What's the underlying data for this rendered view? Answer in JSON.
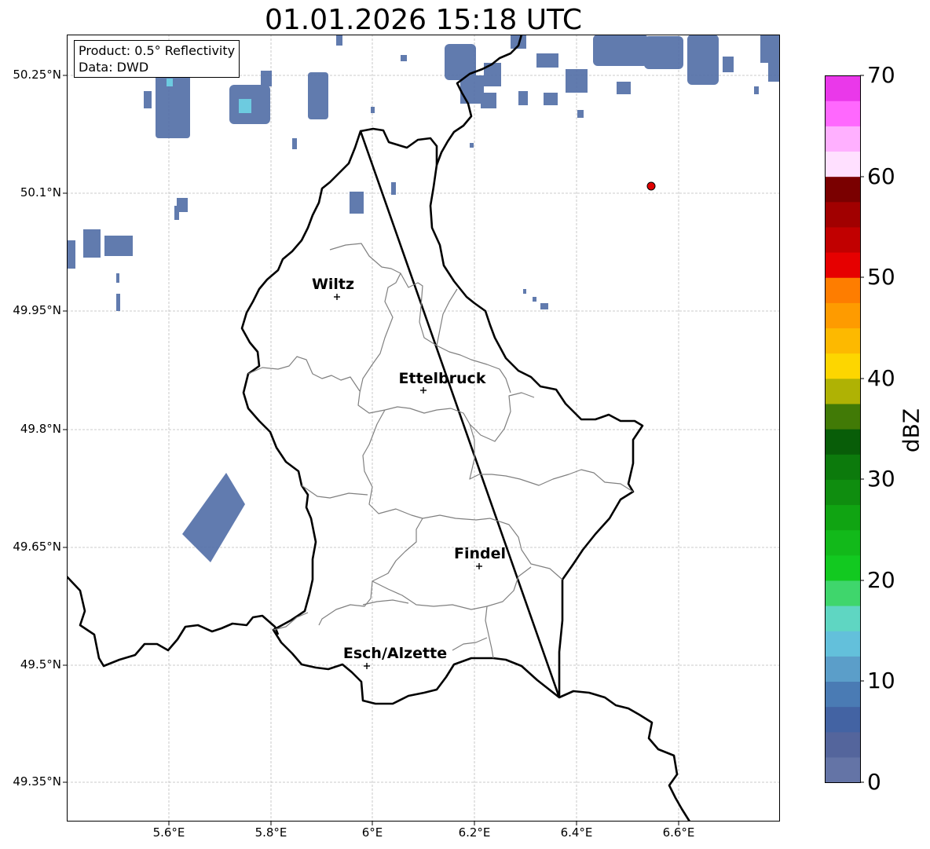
{
  "title": "01.01.2026 15:18 UTC",
  "info": {
    "product": "Product: 0.5° Reflectivity",
    "source": "Data: DWD"
  },
  "axes": {
    "y_ticks": [
      "50.25°N",
      "50.1°N",
      "49.95°N",
      "49.8°N",
      "49.65°N",
      "49.5°N",
      "49.35°N"
    ],
    "x_ticks": [
      "5.6°E",
      "5.8°E",
      "6°E",
      "6.2°E",
      "6.4°E",
      "6.6°E"
    ]
  },
  "cities": [
    {
      "name": "Wiltz"
    },
    {
      "name": "Ettelbruck"
    },
    {
      "name": "Findel"
    },
    {
      "name": "Esch/Alzette"
    }
  ],
  "colorbar": {
    "title": "dBZ",
    "tick_labels": [
      "70",
      "60",
      "50",
      "40",
      "30",
      "20",
      "10",
      "0"
    ],
    "colors": [
      "#6474a6",
      "#54659c",
      "#4363a3",
      "#4a7bb4",
      "#5b9ec9",
      "#63c0db",
      "#5fd6c2",
      "#3fd66c",
      "#12c920",
      "#12b91a",
      "#10a412",
      "#0f8d0f",
      "#0c7a0c",
      "#085d08",
      "#417a06",
      "#afb204",
      "#fdd600",
      "#fdb900",
      "#fe9b00",
      "#fe7d00",
      "#e60000",
      "#c10000",
      "#a10000",
      "#7a0000",
      "#ffe0ff",
      "#ffb0ff",
      "#ff68fe",
      "#ea38ea"
    ]
  },
  "colors": {
    "radar_echo": "#5470a8",
    "radar_echo_strong": "#6dcbe0",
    "station_marker": "#e00000",
    "border": "#000000",
    "canton_border": "#808080"
  }
}
